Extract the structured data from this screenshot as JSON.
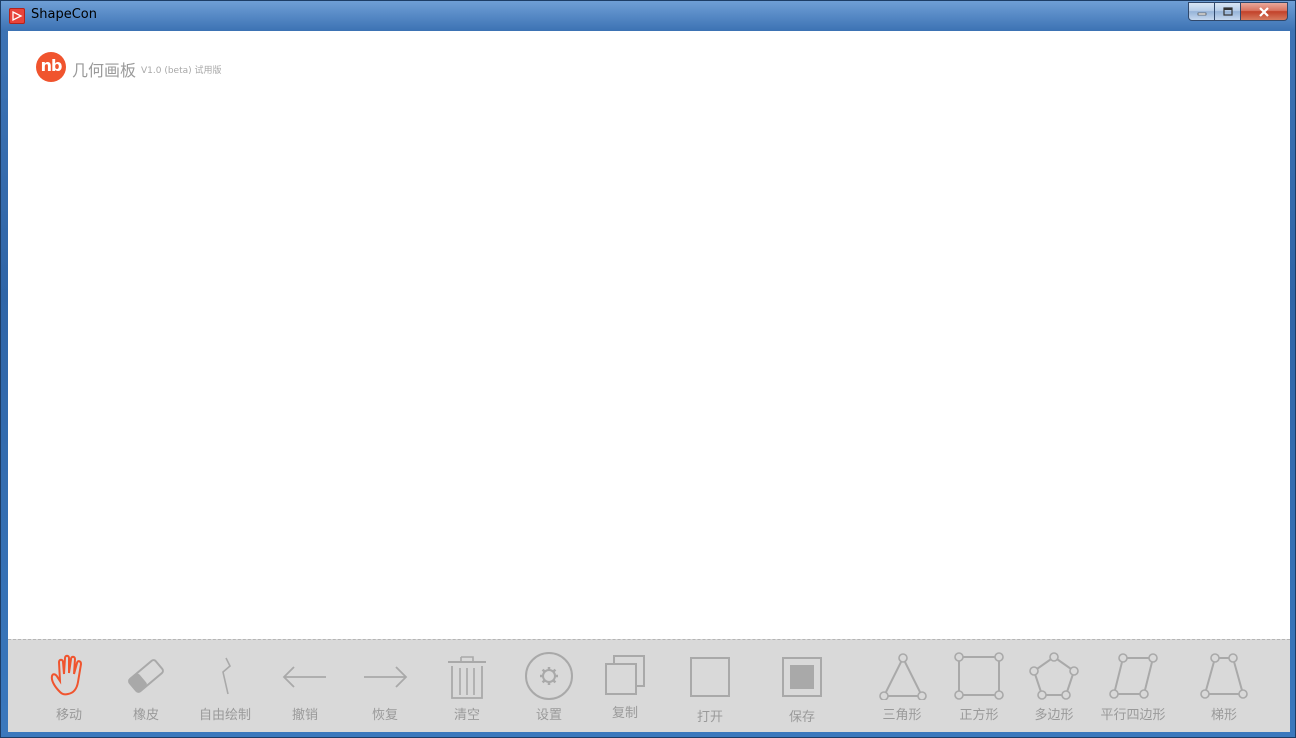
{
  "window": {
    "title": "ShapeCon"
  },
  "app": {
    "logo_text": "nb",
    "name": "几何画板",
    "version": "V1.0 (beta) 试用版"
  },
  "colors": {
    "accent": "#f0542e",
    "tool_icon": "#a9a9a9",
    "active_icon": "#f0542e",
    "toolbar_bg": "#d9d9d9"
  },
  "toolbar": {
    "tools": [
      {
        "id": "move",
        "label": "移动",
        "icon": "hand-icon",
        "active": true
      },
      {
        "id": "eraser",
        "label": "橡皮",
        "icon": "eraser-icon"
      },
      {
        "id": "freehand",
        "label": "自由绘制",
        "icon": "pen-stroke-icon"
      },
      {
        "id": "undo",
        "label": "撤销",
        "icon": "arrow-left-icon"
      },
      {
        "id": "redo",
        "label": "恢复",
        "icon": "arrow-right-icon"
      },
      {
        "id": "clear",
        "label": "清空",
        "icon": "trash-icon"
      },
      {
        "id": "settings",
        "label": "设置",
        "icon": "gear-icon"
      },
      {
        "id": "copy",
        "label": "复制",
        "icon": "copy-icon"
      },
      {
        "id": "open",
        "label": "打开",
        "icon": "open-square-icon"
      },
      {
        "id": "save",
        "label": "保存",
        "icon": "save-square-icon"
      },
      {
        "id": "triangle",
        "label": "三角形",
        "icon": "triangle-icon"
      },
      {
        "id": "square",
        "label": "正方形",
        "icon": "square-shape-icon"
      },
      {
        "id": "polygon",
        "label": "多边形",
        "icon": "pentagon-icon"
      },
      {
        "id": "parallelogram",
        "label": "平行四边形",
        "icon": "parallelogram-icon"
      },
      {
        "id": "trapezoid",
        "label": "梯形",
        "icon": "trapezoid-icon"
      }
    ]
  }
}
